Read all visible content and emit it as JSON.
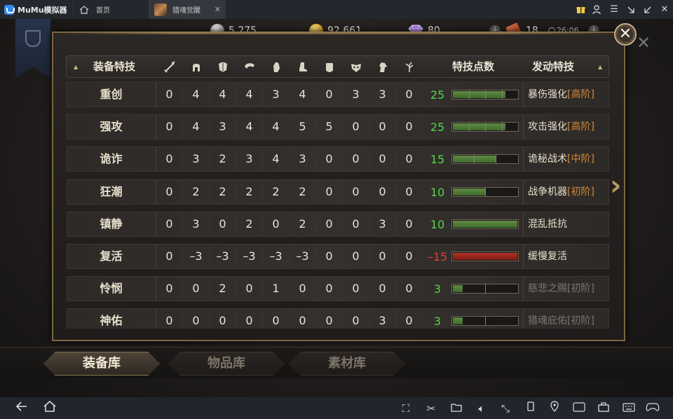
{
  "titlebar": {
    "brand": "MuMu模拟器",
    "tabs": [
      {
        "label": "首页"
      },
      {
        "label": "猎魂觉醒"
      }
    ]
  },
  "currency": {
    "silver": "5,275",
    "gold": "92,661",
    "gems": "80",
    "stamina": "18",
    "timer": "26:06"
  },
  "table": {
    "headers": {
      "skill": "装备特技",
      "points": "特技点数",
      "activated": "发动特技"
    },
    "slot_icons": [
      "sword-icon",
      "helmet-icon",
      "chest-armor-icon",
      "pauldron-icon",
      "glove-icon",
      "boot-icon",
      "charm-icon",
      "mask-icon",
      "horse-icon",
      "plant-icon"
    ],
    "rows": [
      {
        "name": "重创",
        "values": [
          "0",
          "4",
          "4",
          "4",
          "3",
          "4",
          "0",
          "3",
          "3",
          "0"
        ],
        "points": "25",
        "fill": 0.81,
        "negative": false,
        "segments": [
          0.25,
          0.5,
          0.75
        ],
        "effect": "暴伤强化",
        "tier": "[高阶]",
        "dim": false
      },
      {
        "name": "强攻",
        "values": [
          "0",
          "4",
          "3",
          "4",
          "4",
          "5",
          "5",
          "0",
          "0",
          "0"
        ],
        "points": "25",
        "fill": 0.81,
        "negative": false,
        "segments": [
          0.25,
          0.5,
          0.75
        ],
        "effect": "攻击强化",
        "tier": "[高阶]",
        "dim": false
      },
      {
        "name": "诡诈",
        "values": [
          "0",
          "3",
          "2",
          "3",
          "4",
          "3",
          "0",
          "0",
          "0",
          "0"
        ],
        "points": "15",
        "fill": 0.66,
        "negative": false,
        "segments": [
          0.33,
          0.66
        ],
        "effect": "诡秘战术",
        "tier": "[中阶]",
        "dim": false
      },
      {
        "name": "狂潮",
        "values": [
          "0",
          "2",
          "2",
          "2",
          "2",
          "2",
          "0",
          "0",
          "0",
          "0"
        ],
        "points": "10",
        "fill": 0.5,
        "negative": false,
        "segments": [
          0.5
        ],
        "effect": "战争机器",
        "tier": "[初阶]",
        "dim": false
      },
      {
        "name": "镇静",
        "values": [
          "0",
          "3",
          "0",
          "2",
          "0",
          "2",
          "0",
          "0",
          "3",
          "0"
        ],
        "points": "10",
        "fill": 1.0,
        "negative": false,
        "segments": [],
        "effect": "混乱抵抗",
        "tier": "",
        "dim": false
      },
      {
        "name": "复活",
        "values": [
          "0",
          "–3",
          "–3",
          "–3",
          "–3",
          "–3",
          "0",
          "0",
          "0",
          "0"
        ],
        "points": "–15",
        "fill": 1.0,
        "negative": true,
        "segments": [],
        "effect": "缓慢复活",
        "tier": "",
        "dim": false
      },
      {
        "name": "怜悯",
        "values": [
          "0",
          "0",
          "2",
          "0",
          "1",
          "0",
          "0",
          "0",
          "0",
          "0"
        ],
        "points": "3",
        "fill": 0.15,
        "negative": false,
        "segments": [
          0.5
        ],
        "effect": "慈悲之赐",
        "tier": "[初阶]",
        "dim": true
      },
      {
        "name": "神佑",
        "values": [
          "0",
          "0",
          "0",
          "0",
          "0",
          "0",
          "0",
          "0",
          "3",
          "0"
        ],
        "points": "3",
        "fill": 0.15,
        "negative": false,
        "segments": [
          0.5
        ],
        "effect": "猎魂庇佑",
        "tier": "[初阶]",
        "dim": true
      }
    ]
  },
  "bottom_tabs": [
    {
      "label": "装备库",
      "active": true
    },
    {
      "label": "物品库",
      "active": false
    },
    {
      "label": "素材库",
      "active": false
    }
  ],
  "colors": {
    "positive_points": "#57d34b",
    "negative_points": "#e0413a",
    "tier_text": "#d58a32",
    "panel_border": "#7a6542"
  }
}
